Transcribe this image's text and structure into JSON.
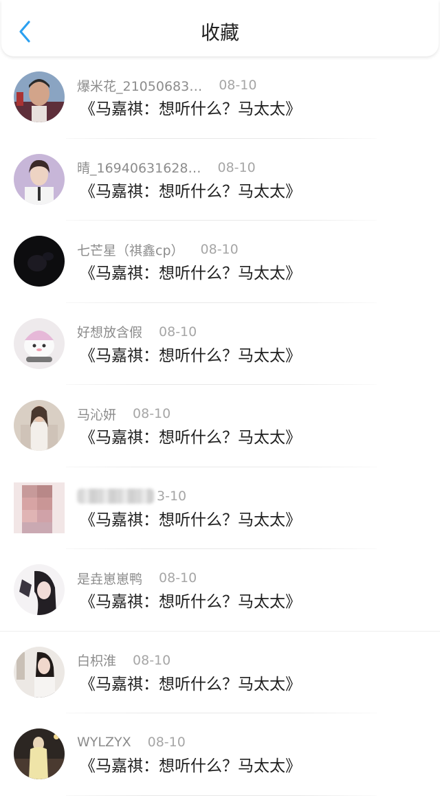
{
  "header": {
    "title": "收藏",
    "back_icon": "chevron-left-icon",
    "accent": "#2ba0f0"
  },
  "items": [
    {
      "name": "爆米花_21050683…",
      "date": "08-10",
      "content": "《马嘉祺：想听什么？马太太》"
    },
    {
      "name": "晴_16940631628…",
      "date": "08-10",
      "content": "《马嘉祺：想听什么？马太太》"
    },
    {
      "name": "七芒星（祺鑫cp）",
      "date": "08-10",
      "content": "《马嘉祺：想听什么？马太太》"
    },
    {
      "name": "好想放含假",
      "date": "08-10",
      "content": "《马嘉祺：想听什么？马太太》"
    },
    {
      "name": "马沁妍",
      "date": "08-10",
      "content": "《马嘉祺：想听什么？马太太》"
    },
    {
      "name": "",
      "date": "3-10",
      "content": "《马嘉祺：想听什么？马太太》"
    },
    {
      "name": "是垚崽崽鸭",
      "date": "08-10",
      "content": "《马嘉祺：想听什么？马太太》"
    },
    {
      "name": "白枳淮",
      "date": "08-10",
      "content": "《马嘉祺：想听什么？马太太》"
    },
    {
      "name": "WYLZYX",
      "date": "08-10",
      "content": "《马嘉祺：想听什么？马太太》"
    }
  ]
}
